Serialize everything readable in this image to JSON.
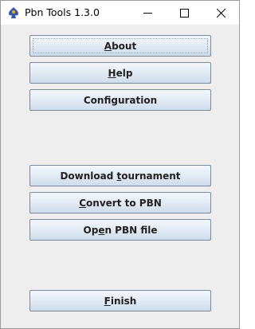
{
  "window": {
    "title": "Pbn Tools 1.3.0",
    "app_icon": "bridge-suit-icon",
    "controls": [
      "minimize-icon",
      "maximize-icon",
      "close-icon"
    ]
  },
  "buttons": [
    {
      "name": "about-button",
      "pre": "",
      "mnemonic": "A",
      "post": "bout",
      "label": "About",
      "focused": true
    },
    {
      "name": "help-button",
      "pre": "",
      "mnemonic": "H",
      "post": "elp",
      "label": "Help",
      "focused": false
    },
    {
      "name": "configuration-button",
      "pre": "Configuration",
      "mnemonic": "",
      "post": "",
      "label": "Configuration",
      "focused": false
    },
    {
      "name": "download-tournament-button",
      "pre": "Download ",
      "mnemonic": "t",
      "post": "ournament",
      "label": "Download tournament",
      "focused": false
    },
    {
      "name": "convert-to-pbn-button",
      "pre": "",
      "mnemonic": "C",
      "post": "onvert to PBN",
      "label": "Convert to PBN",
      "focused": false
    },
    {
      "name": "open-pbn-file-button",
      "pre": "Op",
      "mnemonic": "e",
      "post": "n PBN file",
      "label": "Open PBN file",
      "focused": false
    },
    {
      "name": "finish-button",
      "pre": "",
      "mnemonic": "F",
      "post": "inish",
      "label": "Finish",
      "focused": false
    }
  ]
}
